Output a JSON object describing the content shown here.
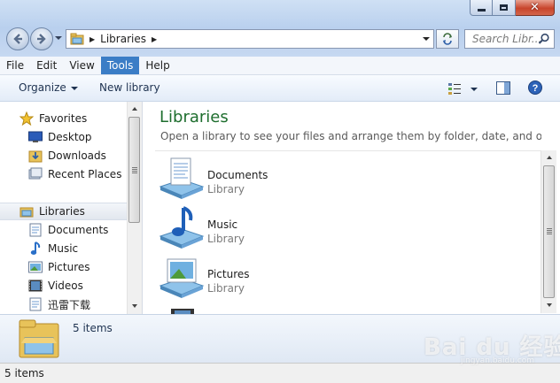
{
  "window": {
    "close_glyph": "✕"
  },
  "address": {
    "path_sep": "▶",
    "location": "Libraries",
    "trail_sep": "▶"
  },
  "search": {
    "placeholder": "Search Libr..."
  },
  "menu": [
    "File",
    "Edit",
    "View",
    "Tools",
    "Help"
  ],
  "menu_active": "Tools",
  "toolbar": {
    "organize": "Organize",
    "new_library": "New library"
  },
  "nav": {
    "favorites": {
      "label": "Favorites",
      "items": [
        "Desktop",
        "Downloads",
        "Recent Places"
      ]
    },
    "libraries": {
      "label": "Libraries",
      "items": [
        "Documents",
        "Music",
        "Pictures",
        "Videos",
        "迅雷下载"
      ]
    }
  },
  "main": {
    "title": "Libraries",
    "subtitle": "Open a library to see your files and arrange them by folder, date, and other pr...",
    "libraries": [
      {
        "name": "Documents",
        "type": "Library",
        "icon": "documents-library-icon"
      },
      {
        "name": "Music",
        "type": "Library",
        "icon": "music-library-icon"
      },
      {
        "name": "Pictures",
        "type": "Library",
        "icon": "pictures-library-icon"
      }
    ]
  },
  "details": {
    "count": "5 items"
  },
  "status": {
    "count": "5 items"
  },
  "watermark": {
    "brand": "Bai du 经验",
    "url": "jingyan.baidu.com"
  },
  "colors": {
    "title_green": "#1e6e2e",
    "menu_active": "#3b7dc6",
    "close_red": "#c8452c"
  }
}
